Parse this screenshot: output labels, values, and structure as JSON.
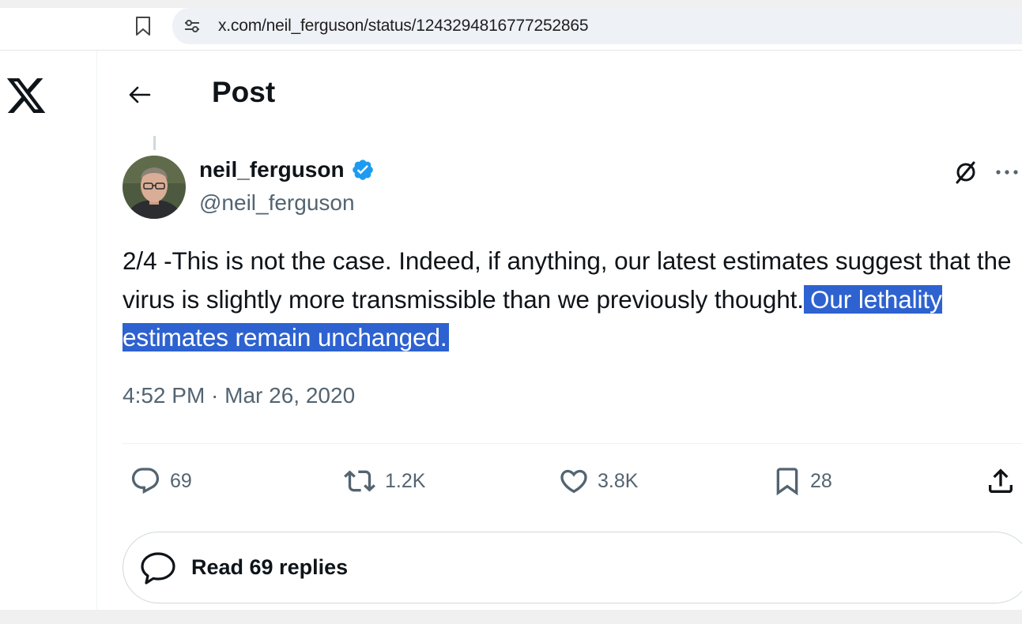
{
  "browser": {
    "url": "x.com/neil_ferguson/status/1243294816777252865",
    "icons": [
      "bookmark-icon",
      "site-info-icon"
    ]
  },
  "nav": {
    "logo": "x-logo"
  },
  "header": {
    "title": "Post",
    "back_icon": "back-arrow-icon"
  },
  "tweet": {
    "author": {
      "display_name": "neil_ferguson",
      "handle": "@neil_ferguson",
      "verified": true
    },
    "text_plain": "2/4 -This is not the case. Indeed, if anything, our latest estimates suggest that the virus is slightly more transmissible than we previously thought.",
    "text_highlighted": "Our lethality estimates remain unchanged.",
    "timestamp": "4:52 PM · Mar 26, 2020",
    "actions": {
      "replies": "69",
      "reposts": "1.2K",
      "likes": "3.8K",
      "bookmarks": "28"
    }
  },
  "read_replies": {
    "label": "Read 69 replies"
  },
  "colors": {
    "highlight": "#2d62d0",
    "verified": "#1d9bf0",
    "secondary_text": "#536471",
    "primary_text": "#0f1419"
  }
}
